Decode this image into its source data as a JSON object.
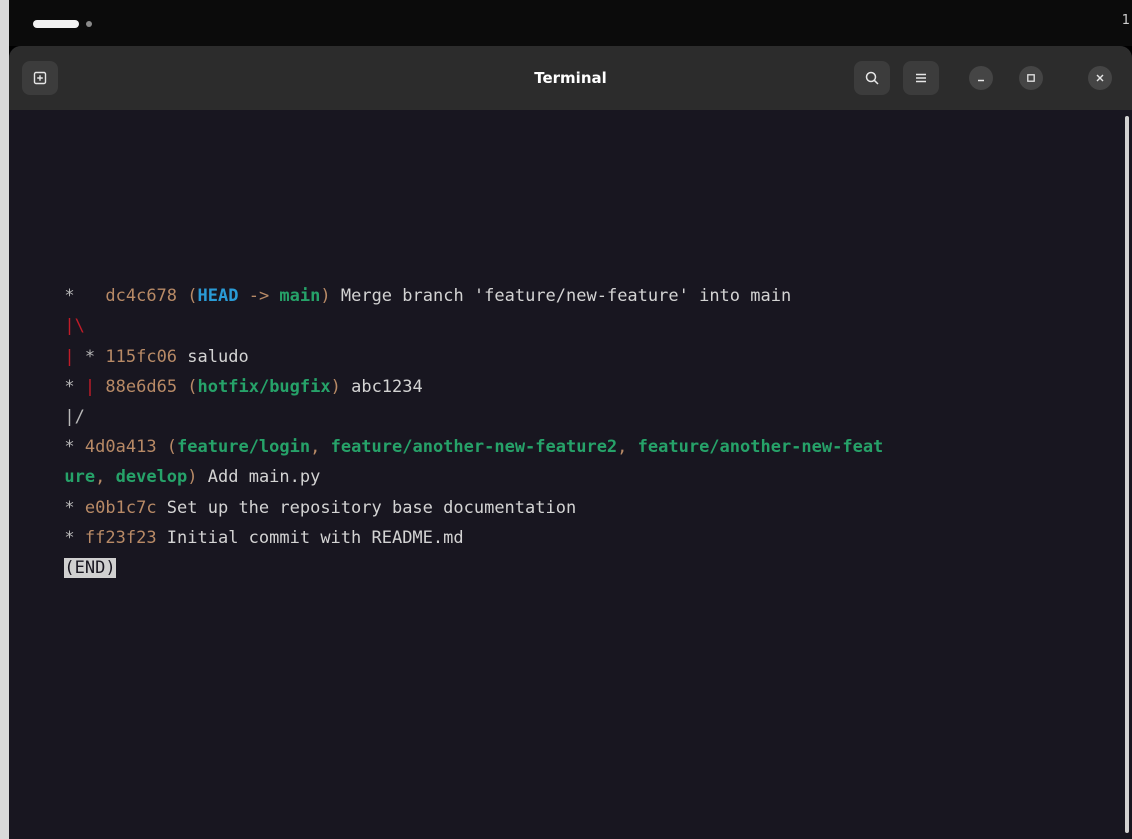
{
  "topbar": {
    "corner_number": "1"
  },
  "window": {
    "title": "Terminal",
    "icons": {
      "new_tab": "new-tab-icon",
      "search": "search-icon",
      "menu": "hamburger-menu-icon",
      "minimize": "minimize-icon",
      "maximize": "maximize-icon",
      "close": "close-icon"
    }
  },
  "terminal": {
    "lines": [
      {
        "graph": "*   ",
        "hash": "dc4c678",
        "open": " (",
        "head": "HEAD",
        "arrow": " -> ",
        "branch": "main",
        "close": ")",
        "message": " Merge branch 'feature/new-feature' into main"
      },
      {
        "graph": "|\\"
      },
      {
        "graph_red": "|",
        "graph": " * ",
        "hash": "115fc06",
        "message": " saludo"
      },
      {
        "graph": "* ",
        "graph_red": "|",
        "graph2": " ",
        "hash": "88e6d65",
        "open": " (",
        "branch": "hotfix/bugfix",
        "close": ")",
        "message": " abc1234"
      },
      {
        "graph": "|/"
      },
      {
        "graph": "* ",
        "hash": "4d0a413",
        "open": " (",
        "branches_a": [
          "feature/login",
          ", ",
          "feature/another-new-feature2",
          ", ",
          "feature/another-new-feat"
        ]
      },
      {
        "branches_b": [
          "ure",
          ", ",
          "develop"
        ],
        "close": ")",
        "message": " Add main.py"
      },
      {
        "graph": "* ",
        "hash": "e0b1c7c",
        "message": " Set up the repository base documentation"
      },
      {
        "graph": "* ",
        "hash": "ff23f23",
        "message": " Initial commit with README.md"
      },
      {
        "end": "(END)"
      }
    ]
  },
  "colors": {
    "background": "#181620",
    "headerbar": "#2c2c2c",
    "hash": "#b88a66",
    "head": "#2a9bd6",
    "branch": "#26a269",
    "graph_red": "#c01c28",
    "text": "#d3d3d3"
  }
}
